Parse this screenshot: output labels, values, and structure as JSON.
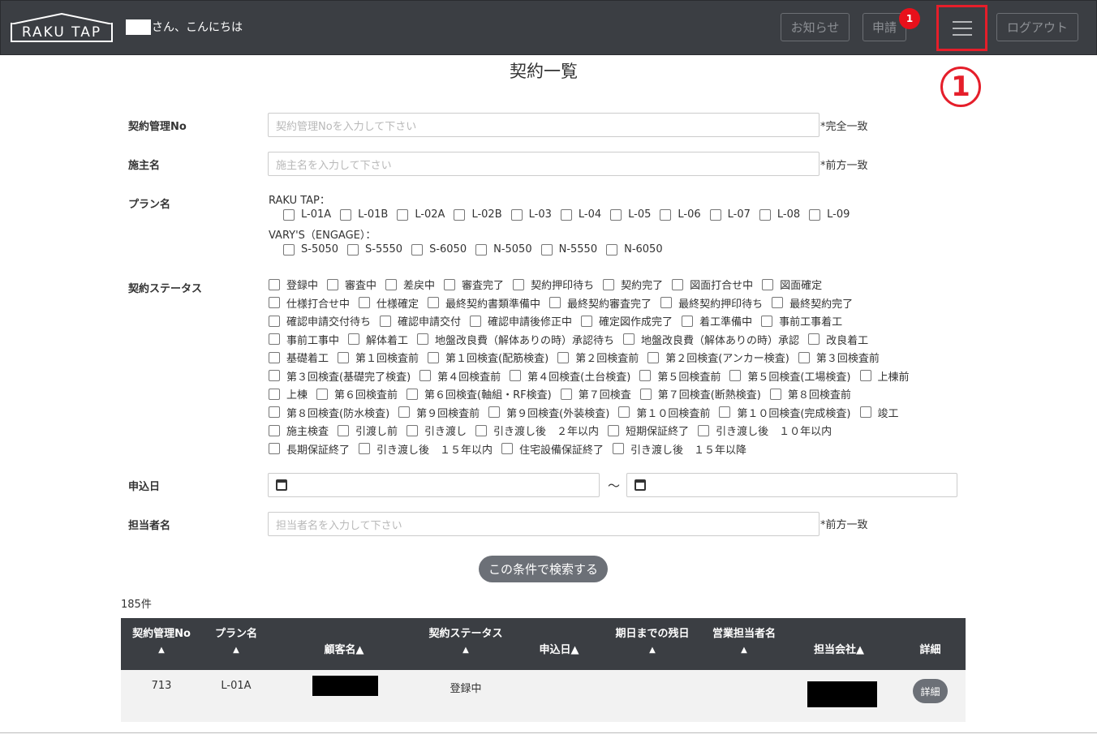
{
  "header": {
    "logo_text": "RAKU TAP",
    "greeting": "さん、こんにちは",
    "notice_label": "お知らせ",
    "apply_label": "申請",
    "apply_badge": "1",
    "logout_label": "ログアウト",
    "menu_icon": "hamburger-icon"
  },
  "annotation": {
    "marker": "1"
  },
  "page": {
    "title": "契約一覧"
  },
  "form": {
    "contract_no": {
      "label": "契約管理No",
      "placeholder": "契約管理Noを入力して下さい",
      "suffix": "*完全一致"
    },
    "owner_name": {
      "label": "施主名",
      "placeholder": "施主名を入力して下さい",
      "suffix": "*前方一致"
    },
    "plan": {
      "label": "プラン名",
      "group1_label": "RAKU TAP：",
      "group1": [
        "L-01A",
        "L-01B",
        "L-02A",
        "L-02B",
        "L-03",
        "L-04",
        "L-05",
        "L-06",
        "L-07",
        "L-08",
        "L-09"
      ],
      "group2_label": "VARY'S（ENGAGE）：",
      "group2": [
        "S-5050",
        "S-5550",
        "S-6050",
        "N-5050",
        "N-5550",
        "N-6050"
      ]
    },
    "status": {
      "label": "契約ステータス",
      "rows": [
        [
          "登録中",
          "審査中",
          "差戻中",
          "審査完了",
          "契約押印待ち",
          "契約完了",
          "図面打合せ中",
          "図面確定"
        ],
        [
          "仕様打合せ中",
          "仕様確定",
          "最終契約書類準備中",
          "最終契約審査完了",
          "最終契約押印待ち",
          "最終契約完了"
        ],
        [
          "確認申請交付待ち",
          "確認申請交付",
          "確認申請後修正中",
          "確定図作成完了",
          "着工準備中",
          "事前工事着工"
        ],
        [
          "事前工事中",
          "解体着工",
          "地盤改良費（解体ありの時）承認待ち",
          "地盤改良費（解体ありの時）承認",
          "改良着工"
        ],
        [
          "基礎着工",
          "第１回検査前",
          "第１回検査(配筋検査)",
          "第２回検査前",
          "第２回検査(アンカー検査)",
          "第３回検査前"
        ],
        [
          "第３回検査(基礎完了検査)",
          "第４回検査前",
          "第４回検査(土台検査)",
          "第５回検査前",
          "第５回検査(工場検査)",
          "上棟前"
        ],
        [
          "上棟",
          "第６回検査前",
          "第６回検査(軸組・RF検査)",
          "第７回検査",
          "第７回検査(断熱検査)",
          "第８回検査前"
        ],
        [
          "第８回検査(防水検査)",
          "第９回検査前",
          "第９回検査(外装検査)",
          "第１０回検査前",
          "第１０回検査(完成検査)",
          "竣工"
        ],
        [
          "施主検査",
          "引渡し前",
          "引き渡し",
          "引き渡し後　２年以内",
          "短期保証終了",
          "引き渡し後　１０年以内"
        ],
        [
          "長期保証終了",
          "引き渡し後　１５年以内",
          "住宅設備保証終了",
          "引き渡し後　１５年以降"
        ]
      ]
    },
    "apply_date": {
      "label": "申込日",
      "separator": "～",
      "icon": "calendar-icon"
    },
    "staff_name": {
      "label": "担当者名",
      "placeholder": "担当者名を入力して下さい",
      "suffix": "*前方一致"
    },
    "search_button": "この条件で検索する"
  },
  "results": {
    "count": "185件",
    "columns": {
      "contract_no": "契約管理No",
      "plan": "プラン名",
      "customer": "顧客名▲",
      "status": "契約ステータス",
      "apply_date": "申込日▲",
      "remaining": "期日までの残日",
      "sales_staff": "営業担当者名",
      "company": "担当会社▲",
      "detail": "詳細",
      "sort_arrow": "▲"
    },
    "rows": [
      {
        "contract_no": "713",
        "plan": "L-01A",
        "status": "登録中",
        "detail_button": "詳細"
      }
    ]
  }
}
